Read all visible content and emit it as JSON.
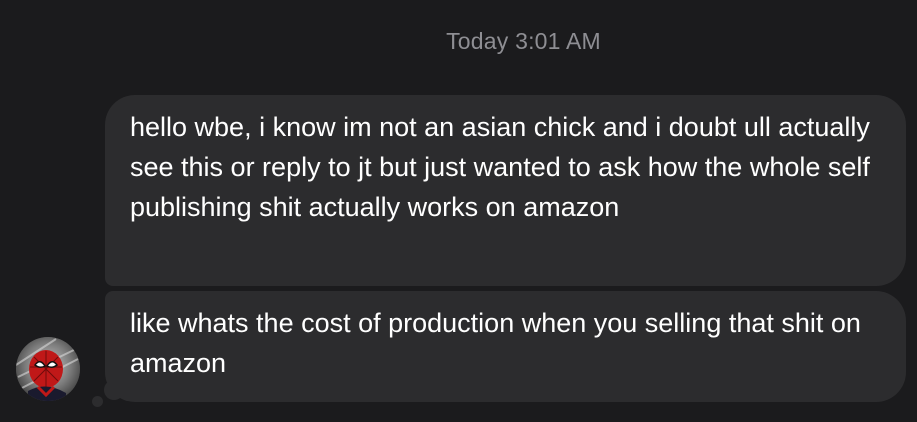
{
  "thread": {
    "timestamp": "Today 3:01 AM"
  },
  "messages": [
    {
      "text": "hello wbe, i know im not an asian chick and i doubt ull actually see this or reply to jt but just wanted to ask how the whole self publishing shit actually works on amazon"
    },
    {
      "text": "like whats the cost of production when you selling that shit on amazon"
    }
  ],
  "sender": {
    "avatar_icon": "spiderman-avatar-icon"
  },
  "colors": {
    "background": "#1b1b1d",
    "bubble": "#2c2c2e",
    "timestamp": "#8e8e93",
    "text": "#ffffff"
  }
}
